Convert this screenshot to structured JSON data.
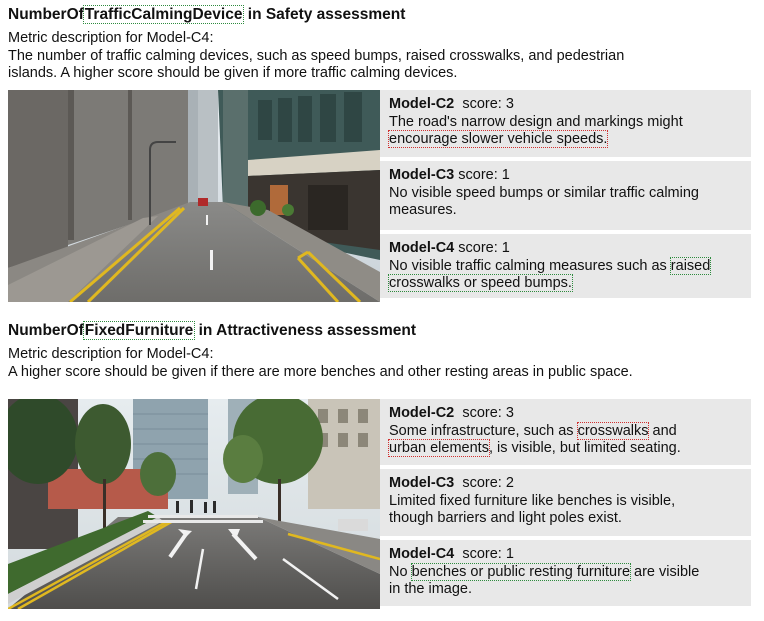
{
  "sections": [
    {
      "title_pre": "NumberOf",
      "title_hl": "TrafficCalmingDevice",
      "title_post": " in Safety assessment",
      "desc_line1": "Metric description for Model-C4:",
      "desc_line2": "The number of traffic calming devices, such as speed bumps, raised crosswalks, and pedestrian",
      "desc_line3": "islands. A higher score should be given if more traffic calming devices.",
      "cards": [
        {
          "model": "Model-C2",
          "score": "score: 3",
          "t1": "The road's narrow design and markings might",
          "t2": "",
          "h1": "encourage slower vehicle speeds.",
          "t3": ""
        },
        {
          "model": "Model-C3",
          "score": "score: 1",
          "t1": "No visible speed bumps or similar traffic calming",
          "t2": "measures."
        },
        {
          "model": "Model-C4",
          "score": "score: 1",
          "t1": "No visible traffic calming measures such as ",
          "h1": "raised",
          "h2": "crosswalks or speed bumps."
        }
      ]
    },
    {
      "title_pre": "NumberOf",
      "title_hl": "FixedFurniture",
      "title_post": " in Attractiveness assessment",
      "desc_line1": "Metric description for Model-C4:",
      "desc_line2": "A higher score should be given if there are more benches and other resting areas in public space.",
      "cards": [
        {
          "model": "Model-C2",
          "score": "score: 3",
          "t1": "Some infrastructure, such as ",
          "h1": "crosswalks",
          "t2": " and",
          "h2": "urban elements",
          "t3": ", is visible, but limited seating."
        },
        {
          "model": "Model-C3",
          "score": "score: 2",
          "t1": "Limited fixed furniture like benches is visible,",
          "t2": "though barriers and light poles exist."
        },
        {
          "model": "Model-C4",
          "score": "score: 1",
          "t1": "No ",
          "h1": "benches or public resting furniture",
          "t2": " are visible",
          "t3": "in the image."
        }
      ]
    }
  ]
}
